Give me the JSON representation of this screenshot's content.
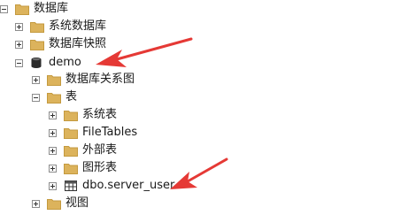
{
  "tree": {
    "root": {
      "label": "数据库",
      "icon": "folder-icon"
    },
    "system_databases": {
      "label": "系统数据库",
      "icon": "folder-icon"
    },
    "db_snapshots": {
      "label": "数据库快照",
      "icon": "folder-icon"
    },
    "demo": {
      "label": "demo",
      "icon": "database-icon"
    },
    "diagrams": {
      "label": "数据库关系图",
      "icon": "folder-icon"
    },
    "tables": {
      "label": "表",
      "icon": "folder-icon"
    },
    "system_tables": {
      "label": "系统表",
      "icon": "folder-icon"
    },
    "filetables": {
      "label": "FileTables",
      "icon": "folder-icon"
    },
    "external_tables": {
      "label": "外部表",
      "icon": "folder-icon"
    },
    "graph_tables": {
      "label": "图形表",
      "icon": "folder-icon"
    },
    "server_user": {
      "label": "dbo.server_user",
      "icon": "table-icon"
    },
    "views": {
      "label": "视图",
      "icon": "folder-icon"
    }
  },
  "colors": {
    "folder": "#dcb35c",
    "arrow": "#e53935"
  }
}
